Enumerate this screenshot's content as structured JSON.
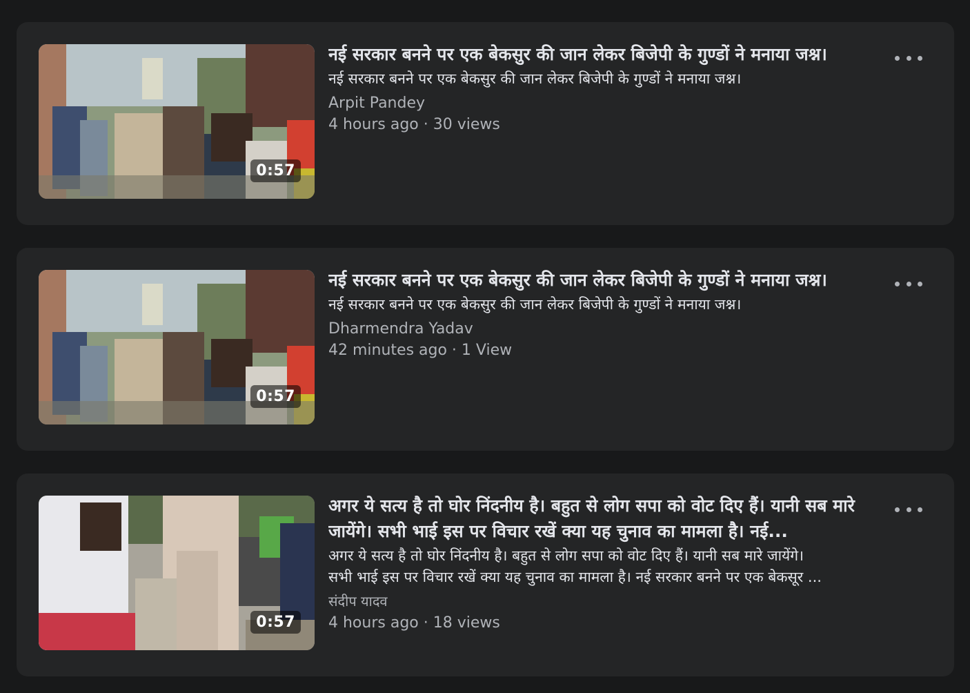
{
  "videos": [
    {
      "duration": "0:57",
      "title": "नई सरकार बनने पर एक बेकसुर की जान लेकर बिजेपी के गुण्डों ने मनाया जश्न।",
      "description": "नई सरकार बनने पर एक बेकसुर की जान लेकर बिजेपी के गुण्डों ने मनाया जश्न।",
      "author": "Arpit Pandey",
      "meta": "4 hours ago · 30 views",
      "thumbnail_icon": "blurred-street-crowd-thumbnail"
    },
    {
      "duration": "0:57",
      "title": "नई सरकार बनने पर एक बेकसुर की जान लेकर बिजेपी के गुण्डों ने मनाया जश्न।",
      "description": "नई सरकार बनने पर एक बेकसुर की जान लेकर बिजेपी के गुण्डों ने मनाया जश्न।",
      "author": "Dharmendra Yadav",
      "meta": "42 minutes ago · 1 View",
      "thumbnail_icon": "blurred-street-crowd-thumbnail"
    },
    {
      "duration": "0:57",
      "title": "अगर ये सत्य है तो घोर निंदनीय है। बहुत से लोग सपा को वोट दिए हैं। यानी सब मारे जायेंगे। सभी भाई इस पर विचार रखें क्या यह चुनाव का मामला है। नई...",
      "description_lines": [
        "अगर ये सत्य है तो घोर निंदनीय है। बहुत से लोग सपा को वोट दिए हैं। यानी सब मारे जायेंगे।",
        "सभी भाई इस पर विचार रखें क्या यह चुनाव का मामला है। नई सरकार बनने पर एक बेकसूर ..."
      ],
      "author": "संदीप यादव",
      "meta": "4 hours ago · 18 views",
      "thumbnail_icon": "street-scene-men-motorbike-thumbnail"
    }
  ],
  "more_icon": "ellipsis-horizontal-icon",
  "colors": {
    "page_bg": "#18191a",
    "card_bg": "#242526",
    "primary_text": "#e4e6eb",
    "secondary_text": "#b0b3b8"
  }
}
